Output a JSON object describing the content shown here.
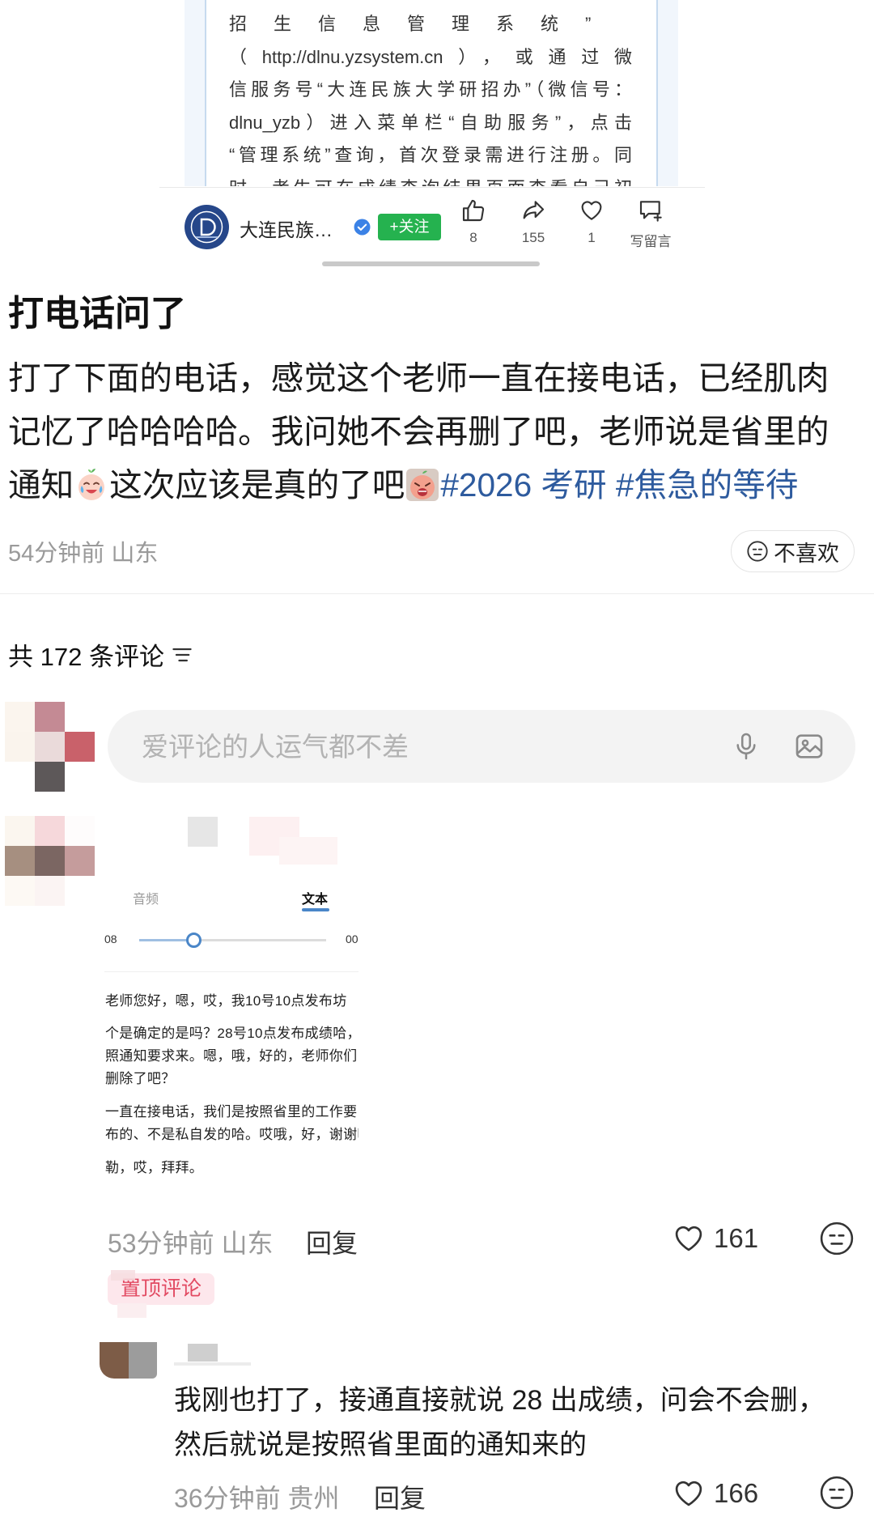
{
  "article": {
    "lines": [
      "招生信息管理系统”",
      "（http://dlnu.yzsystem.cn），或通过微",
      "信服务号“大连民族大学研招办”（微信号：",
      "dlnu_yzb）进入菜单栏“自助服务”，点击",
      "“管理系统”查询，首次登录需进行注册。同",
      "时，考生可在成绩查询结果页面查看自己初"
    ],
    "account_name": "大连民族…",
    "follow_label": "+关注",
    "actions": {
      "like_count": "8",
      "share_count": "155",
      "favorite_count": "1",
      "comment_label": "写留言"
    }
  },
  "post": {
    "title": "打电话问了",
    "body_line1": "打了下面的电话，感觉这个老师一直在接电话，已经肌肉",
    "body_line2": "记忆了哈哈哈哈。我问她不会再删了吧，老师说是省里的",
    "body_line3_start": "通知",
    "body_line3_middle": "这次应该是真的了吧",
    "emoji_1": "crying-emoji",
    "emoji_2": "tired-emoji",
    "hashtags": [
      "#2026 考研",
      "#焦急的等待"
    ],
    "time": "54分钟前",
    "location": "山东",
    "dislike_label": "不喜欢"
  },
  "comments_header": {
    "label": "共 172 条评论"
  },
  "comment_input": {
    "placeholder": "爱评论的人运气都不差"
  },
  "comments": [
    {
      "transcript_image": {
        "tabs": [
          "音频",
          "文本"
        ],
        "time_start": "08",
        "time_end": "00",
        "playback_progress": 0.29,
        "lines": [
          "老师您好，嗯，哎，我10号10点发布坊",
          "个是确定的是吗？28号10点发布成绩哈，",
          "照通知要求来。嗯，哦，好的，老师你们",
          "删除了吧？",
          "一直在接电话，我们是按照省里的工作要",
          "布的、不是私自发的哈。哎哦，好，谢谢叩",
          "勒，哎，拜拜。"
        ]
      },
      "time": "53分钟前",
      "location": "山东",
      "reply_label": "回复",
      "likes": "161",
      "badge": "置顶评论",
      "replies": [
        {
          "text_lines": [
            "我刚也打了，接通直接就说 28 出成绩，问会不会删，",
            "然后就说是按照省里面的通知来的"
          ],
          "time": "36分钟前",
          "location": "贵州",
          "reply_label": "回复",
          "likes": "166"
        }
      ]
    }
  ],
  "colors": {
    "hashtag": "#2e5b9e",
    "follow": "#25b24f",
    "verified": "#3b82e6",
    "pin-text": "#e24a62",
    "pin-bg": "#fde7ec",
    "slider": "#4a86c8"
  }
}
